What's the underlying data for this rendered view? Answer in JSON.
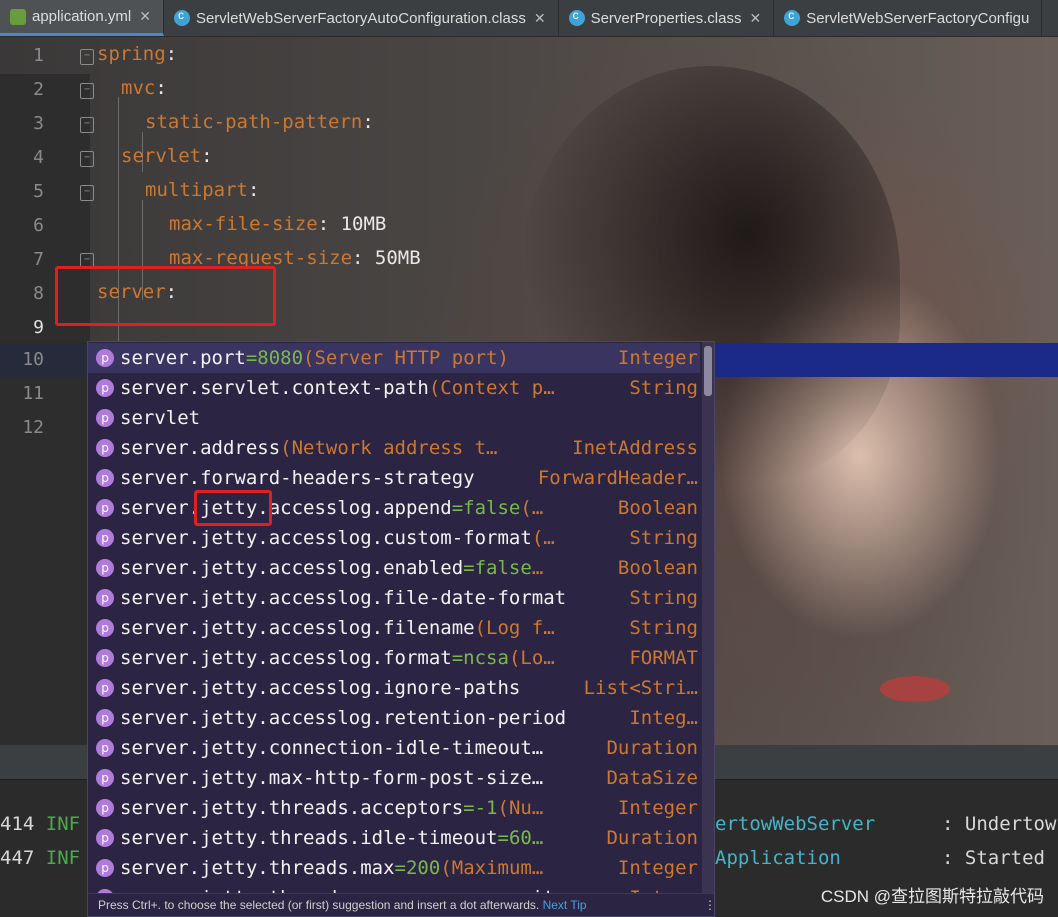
{
  "tabs": [
    {
      "label": "application.yml",
      "icon": "yaml-file-icon",
      "active": true
    },
    {
      "label": "ServletWebServerFactoryAutoConfiguration.class",
      "icon": "class-file-icon"
    },
    {
      "label": "ServerProperties.class",
      "icon": "class-file-icon"
    },
    {
      "label": "ServletWebServerFactoryConfigu",
      "icon": "class-file-icon"
    }
  ],
  "editor": {
    "lines": [
      {
        "n": "1",
        "key": "spring",
        "sep": ":",
        "val": ""
      },
      {
        "n": "2",
        "key": "mvc",
        "sep": ":",
        "val": ""
      },
      {
        "n": "3",
        "key": "static-path-pattern",
        "sep": ":",
        "val": ""
      },
      {
        "n": "4",
        "key": "servlet",
        "sep": ":",
        "val": ""
      },
      {
        "n": "5",
        "key": "multipart",
        "sep": ":",
        "val": ""
      },
      {
        "n": "6",
        "key": "max-file-size",
        "sep": ":",
        "val": " 10MB"
      },
      {
        "n": "7",
        "key": "max-request-size",
        "sep": ":",
        "val": " 50MB"
      },
      {
        "n": "8",
        "key": "server",
        "sep": ":",
        "val": ""
      },
      {
        "n": "9",
        "key": "",
        "sep": "",
        "val": ""
      },
      {
        "n": "10",
        "key": "",
        "sep": "",
        "val": ""
      },
      {
        "n": "11",
        "key": "",
        "sep": "",
        "val": ""
      },
      {
        "n": "12",
        "key": "",
        "sep": "",
        "val": ""
      }
    ]
  },
  "completion": {
    "items": [
      {
        "name": "server.port",
        "default": "=8080",
        "desc": " (Server HTTP port)",
        "type": "Integer"
      },
      {
        "name": "server.servlet.context-path",
        "default": "",
        "desc": " (Context p…",
        "type": "String"
      },
      {
        "name": "servlet",
        "default": "",
        "desc": "",
        "type": ""
      },
      {
        "name": "server.address",
        "default": "",
        "desc": " (Network address t…",
        "type": "InetAddress"
      },
      {
        "name": "server.forward-headers-strategy",
        "default": "",
        "desc": "",
        "type": "ForwardHeader…"
      },
      {
        "name": "server.jetty.accesslog.append",
        "default": "=false",
        "desc": " (…",
        "type": "Boolean"
      },
      {
        "name": "server.jetty.accesslog.custom-format",
        "default": "",
        "desc": " (…",
        "type": "String"
      },
      {
        "name": "server.jetty.accesslog.enabled",
        "default": "=false",
        "desc": " …",
        "type": "Boolean"
      },
      {
        "name": "server.jetty.accesslog.file-date-format",
        "default": "",
        "desc": "",
        "type": "String"
      },
      {
        "name": "server.jetty.accesslog.filename",
        "default": "",
        "desc": " (Log f…",
        "type": "String"
      },
      {
        "name": "server.jetty.accesslog.format",
        "default": "=ncsa",
        "desc": " (Lo…",
        "type": "FORMAT"
      },
      {
        "name": "server.jetty.accesslog.ignore-paths",
        "default": "",
        "desc": "",
        "type": "List<Stri…"
      },
      {
        "name": "server.jetty.accesslog.retention-period",
        "default": "",
        "desc": "",
        "type": "Integ…"
      },
      {
        "name": "server.jetty.connection-idle-timeout…",
        "default": "",
        "desc": "",
        "type": "Duration"
      },
      {
        "name": "server.jetty.max-http-form-post-size…",
        "default": "",
        "desc": "",
        "type": "DataSize"
      },
      {
        "name": "server.jetty.threads.acceptors",
        "default": "=-1",
        "desc": " (Nu…",
        "type": "Integer"
      },
      {
        "name": "server.jetty.threads.idle-timeout",
        "default": "=60…",
        "desc": "",
        "type": "Duration"
      },
      {
        "name": "server.jetty.threads.max",
        "default": "=200",
        "desc": " (Maximum…",
        "type": "Integer"
      },
      {
        "name": "server.jetty.threads.max-queue-capacity",
        "default": "",
        "desc": "",
        "type": "Integ…"
      }
    ],
    "hint": "Press Ctrl+. to choose the selected (or first) suggestion and insert a dot afterwards.",
    "hint_link": "Next Tip",
    "hint_dots": "⋮"
  },
  "console": {
    "rows": [
      {
        "num": "414",
        "level": "INF",
        "cls": "ertowWebServer",
        "sep": ":",
        "msg": "Undertow"
      },
      {
        "num": "447",
        "level": "INF",
        "cls": "Application",
        "sep": ":",
        "msg": "Started"
      }
    ]
  },
  "watermark": "CSDN @查拉图斯特拉敲代码"
}
